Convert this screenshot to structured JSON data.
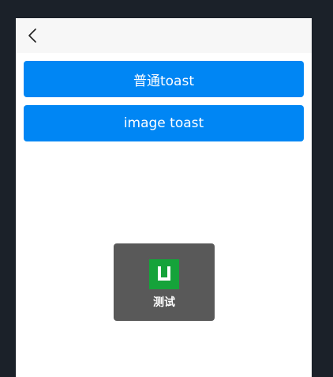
{
  "colors": {
    "background": "#1b2129",
    "navbar": "#f7f7f7",
    "button": "#0086f4",
    "toast_bg": "#595959",
    "toast_icon": "#15a33a"
  },
  "nav": {
    "back_icon": "chevron-left-icon"
  },
  "buttons": [
    {
      "label": "普通toast"
    },
    {
      "label": "image toast"
    }
  ],
  "toast": {
    "icon": "app-logo-icon",
    "text": "测试"
  }
}
